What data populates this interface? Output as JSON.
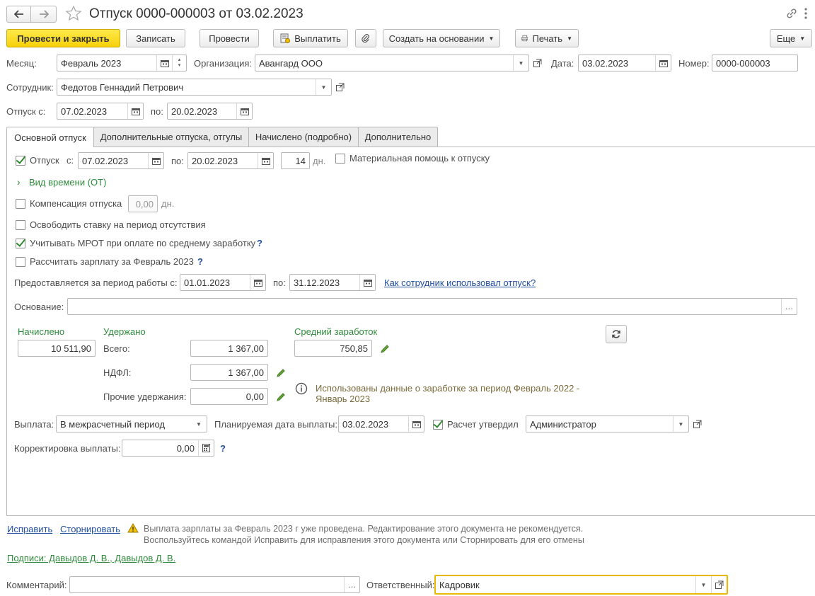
{
  "window": {
    "title": "Отпуск 0000-000003 от 03.02.2023"
  },
  "toolbar": {
    "post_close": "Провести и закрыть",
    "save": "Записать",
    "post": "Провести",
    "pay": "Выплатить",
    "create_based": "Создать на основании",
    "print": "Печать",
    "more": "Еще"
  },
  "header": {
    "month_label": "Месяц:",
    "month_value": "Февраль 2023",
    "org_label": "Организация:",
    "org_value": "Авангард ООО",
    "date_label": "Дата:",
    "date_value": "03.02.2023",
    "number_label": "Номер:",
    "number_value": "0000-000003",
    "employee_label": "Сотрудник:",
    "employee_value": "Федотов Геннадий Петрович",
    "vac_from_label": "Отпуск с:",
    "vac_from_value": "07.02.2023",
    "vac_to_label": "по:",
    "vac_to_value": "20.02.2023"
  },
  "tabs": [
    {
      "label": "Основной отпуск"
    },
    {
      "label": "Дополнительные отпуска, отгулы"
    },
    {
      "label": "Начислено (подробно)"
    },
    {
      "label": "Дополнительно"
    }
  ],
  "main": {
    "vacation_label": "Отпуск",
    "from_label": "с:",
    "from_value": "07.02.2023",
    "to_label": "по:",
    "to_value": "20.02.2023",
    "days_value": "14",
    "days_unit": "дн.",
    "material_help": "Материальная помощь к отпуску",
    "time_type": "Вид времени (ОТ)",
    "compensation_label": "Компенсация отпуска",
    "compensation_value": "0,00",
    "compensation_unit": "дн.",
    "free_rate": "Освободить ставку на период отсутствия",
    "mrot": "Учитывать МРОТ при оплате по среднему заработку",
    "calc_salary": "Рассчитать зарплату за Февраль 2023",
    "work_period_label": "Предоставляется за период работы с:",
    "work_from": "01.01.2023",
    "work_to_label": "по:",
    "work_to": "31.12.2023",
    "how_used_link": "Как сотрудник использовал отпуск?",
    "basis_label": "Основание:",
    "basis_value": "",
    "accrued_label": "Начислено",
    "accrued_value": "10 511,90",
    "withheld_label": "Удержано",
    "total_label": "Всего:",
    "total_value": "1 367,00",
    "ndfl_label": "НДФЛ:",
    "ndfl_value": "1 367,00",
    "other_label": "Прочие удержания:",
    "other_value": "0,00",
    "avg_label": "Средний заработок",
    "avg_value": "750,85",
    "info_text_1": "Использованы данные о заработке за период Февраль 2022 -",
    "info_text_2": "Январь 2023",
    "payment_label": "Выплата:",
    "payment_value": "В межрасчетный период",
    "plan_date_label": "Планируемая дата выплаты:",
    "plan_date_value": "03.02.2023",
    "approved_label": "Расчет утвердил",
    "approved_value": "Администратор",
    "adjust_label": "Корректировка выплаты:",
    "adjust_value": "0,00",
    "q": "?"
  },
  "footer": {
    "fix_link": "Исправить",
    "storno_link": "Сторнировать",
    "warning_1": "Выплата зарплаты за Февраль 2023 г уже проведена. Редактирование этого документа не рекомендуется.",
    "warning_2": "Воспользуйтесь командой Исправить для исправления этого документа или Сторнировать для его отмены",
    "signatures": "Подписи: Давыдов Д. В., Давыдов Д. В.",
    "comment_label": "Комментарий:",
    "comment_value": "",
    "responsible_label": "Ответственный:",
    "responsible_value": "Кадровик"
  },
  "colors": {
    "accent": "#f6d10a",
    "link": "#1f4fa0",
    "green": "#2d8a3a",
    "focus": "#e8b800"
  }
}
